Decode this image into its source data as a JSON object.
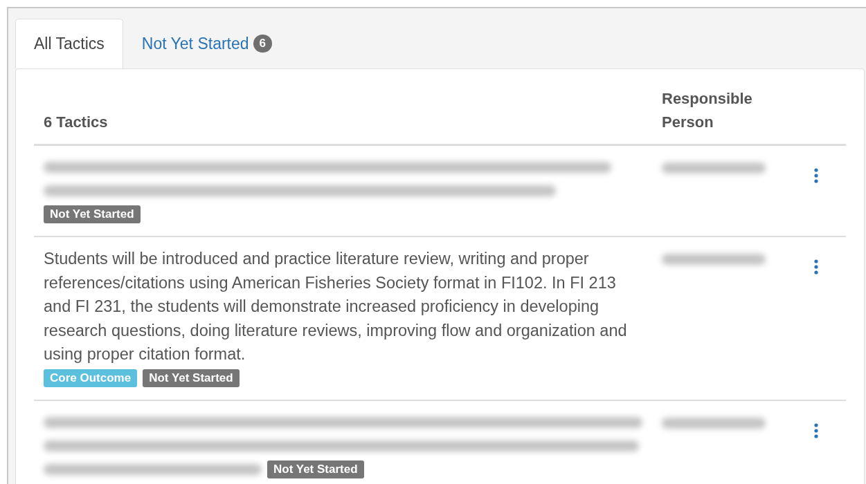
{
  "tabs": [
    {
      "label": "All Tactics",
      "selected": true
    },
    {
      "label": "Not Yet Started",
      "count": "6",
      "selected": false
    }
  ],
  "table": {
    "columns": [
      "6 Tactics",
      "Responsible Person"
    ],
    "rows": [
      {
        "description": {
          "kind": "blurred",
          "badge_inline": false
        },
        "badges": [
          {
            "label": "Not Yet Started",
            "kind": "status"
          }
        ],
        "person": {
          "kind": "blurred"
        }
      },
      {
        "description": {
          "kind": "text",
          "text": "Students will be introduced and practice literature review, writing and proper references/citations using American Fisheries Society format in FI102. In FI 213 and FI 231, the students will demonstrate increased proficiency in developing research questions, doing literature reviews, improving flow and organization and using proper citation format."
        },
        "badges": [
          {
            "label": "Core Outcome",
            "kind": "core"
          },
          {
            "label": "Not Yet Started",
            "kind": "status"
          }
        ],
        "person": {
          "kind": "blurred"
        }
      },
      {
        "description": {
          "kind": "blurred",
          "badge_inline": true
        },
        "badges": [
          {
            "label": "Not Yet Started",
            "kind": "status"
          }
        ],
        "person": {
          "kind": "blurred"
        }
      }
    ]
  }
}
